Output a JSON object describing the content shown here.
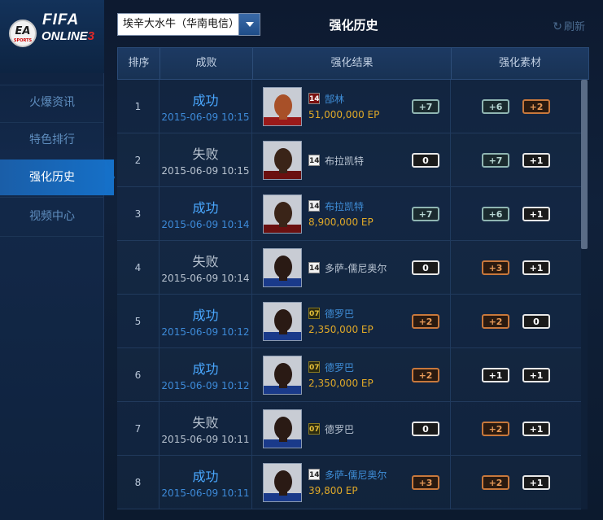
{
  "app": {
    "logo_ea": "EA",
    "logo_sports": "SPORTS",
    "logo_fifa": "FIFA",
    "logo_online": "ONLINE",
    "logo_num": "3"
  },
  "sidebar": {
    "items": [
      {
        "label": "火爆资讯",
        "active": false
      },
      {
        "label": "特色排行",
        "active": false
      },
      {
        "label": "强化历史",
        "active": true
      },
      {
        "label": "视频中心",
        "active": false
      }
    ]
  },
  "topbar": {
    "server": "埃辛大水牛（华南电信）",
    "title": "强化历史",
    "refresh": "刷新"
  },
  "table": {
    "headers": [
      "排序",
      "成败",
      "强化结果",
      "强化素材"
    ],
    "rows": [
      {
        "idx": "1",
        "result": "成功",
        "ok": true,
        "date": "2015-06-09 10:15",
        "level": "14",
        "levelStyle": "red",
        "player": "郜林",
        "ep": "51,000,000 EP",
        "outcome": "+7",
        "outcomeStyle": "teal",
        "mats": [
          {
            "v": "+6",
            "s": "teal"
          },
          {
            "v": "+2",
            "s": "orange"
          }
        ]
      },
      {
        "idx": "2",
        "result": "失败",
        "ok": false,
        "date": "2015-06-09 10:15",
        "level": "14",
        "levelStyle": "white",
        "player": "布拉凯特",
        "ep": "",
        "outcome": "0",
        "outcomeStyle": "white",
        "mats": [
          {
            "v": "+7",
            "s": "teal"
          },
          {
            "v": "+1",
            "s": "white"
          }
        ]
      },
      {
        "idx": "3",
        "result": "成功",
        "ok": true,
        "date": "2015-06-09 10:14",
        "level": "14",
        "levelStyle": "white",
        "player": "布拉凯特",
        "ep": "8,900,000 EP",
        "outcome": "+7",
        "outcomeStyle": "teal",
        "mats": [
          {
            "v": "+6",
            "s": "teal"
          },
          {
            "v": "+1",
            "s": "white"
          }
        ]
      },
      {
        "idx": "4",
        "result": "失败",
        "ok": false,
        "date": "2015-06-09 10:14",
        "level": "14",
        "levelStyle": "white",
        "player": "多萨-儒尼奥尔",
        "ep": "",
        "outcome": "0",
        "outcomeStyle": "white",
        "mats": [
          {
            "v": "+3",
            "s": "orange"
          },
          {
            "v": "+1",
            "s": "white"
          }
        ]
      },
      {
        "idx": "5",
        "result": "成功",
        "ok": true,
        "date": "2015-06-09 10:12",
        "level": "07",
        "levelStyle": "gold",
        "player": "德罗巴",
        "ep": "2,350,000 EP",
        "outcome": "+2",
        "outcomeStyle": "orange",
        "mats": [
          {
            "v": "+2",
            "s": "orange"
          },
          {
            "v": "0",
            "s": "white"
          }
        ]
      },
      {
        "idx": "6",
        "result": "成功",
        "ok": true,
        "date": "2015-06-09 10:12",
        "level": "07",
        "levelStyle": "gold",
        "player": "德罗巴",
        "ep": "2,350,000 EP",
        "outcome": "+2",
        "outcomeStyle": "orange",
        "mats": [
          {
            "v": "+1",
            "s": "white"
          },
          {
            "v": "+1",
            "s": "white"
          }
        ]
      },
      {
        "idx": "7",
        "result": "失败",
        "ok": false,
        "date": "2015-06-09 10:11",
        "level": "07",
        "levelStyle": "gold",
        "player": "德罗巴",
        "ep": "",
        "outcome": "0",
        "outcomeStyle": "white",
        "mats": [
          {
            "v": "+2",
            "s": "orange"
          },
          {
            "v": "+1",
            "s": "white"
          }
        ]
      },
      {
        "idx": "8",
        "result": "成功",
        "ok": true,
        "date": "2015-06-09 10:11",
        "level": "14",
        "levelStyle": "white",
        "player": "多萨-儒尼奥尔",
        "ep": "39,800 EP",
        "outcome": "+3",
        "outcomeStyle": "orange",
        "mats": [
          {
            "v": "+2",
            "s": "orange"
          },
          {
            "v": "+1",
            "s": "white"
          }
        ]
      }
    ]
  },
  "colors": {
    "accent": "#1570c8",
    "success": "#4aa8ff",
    "ep": "#e0a928"
  }
}
